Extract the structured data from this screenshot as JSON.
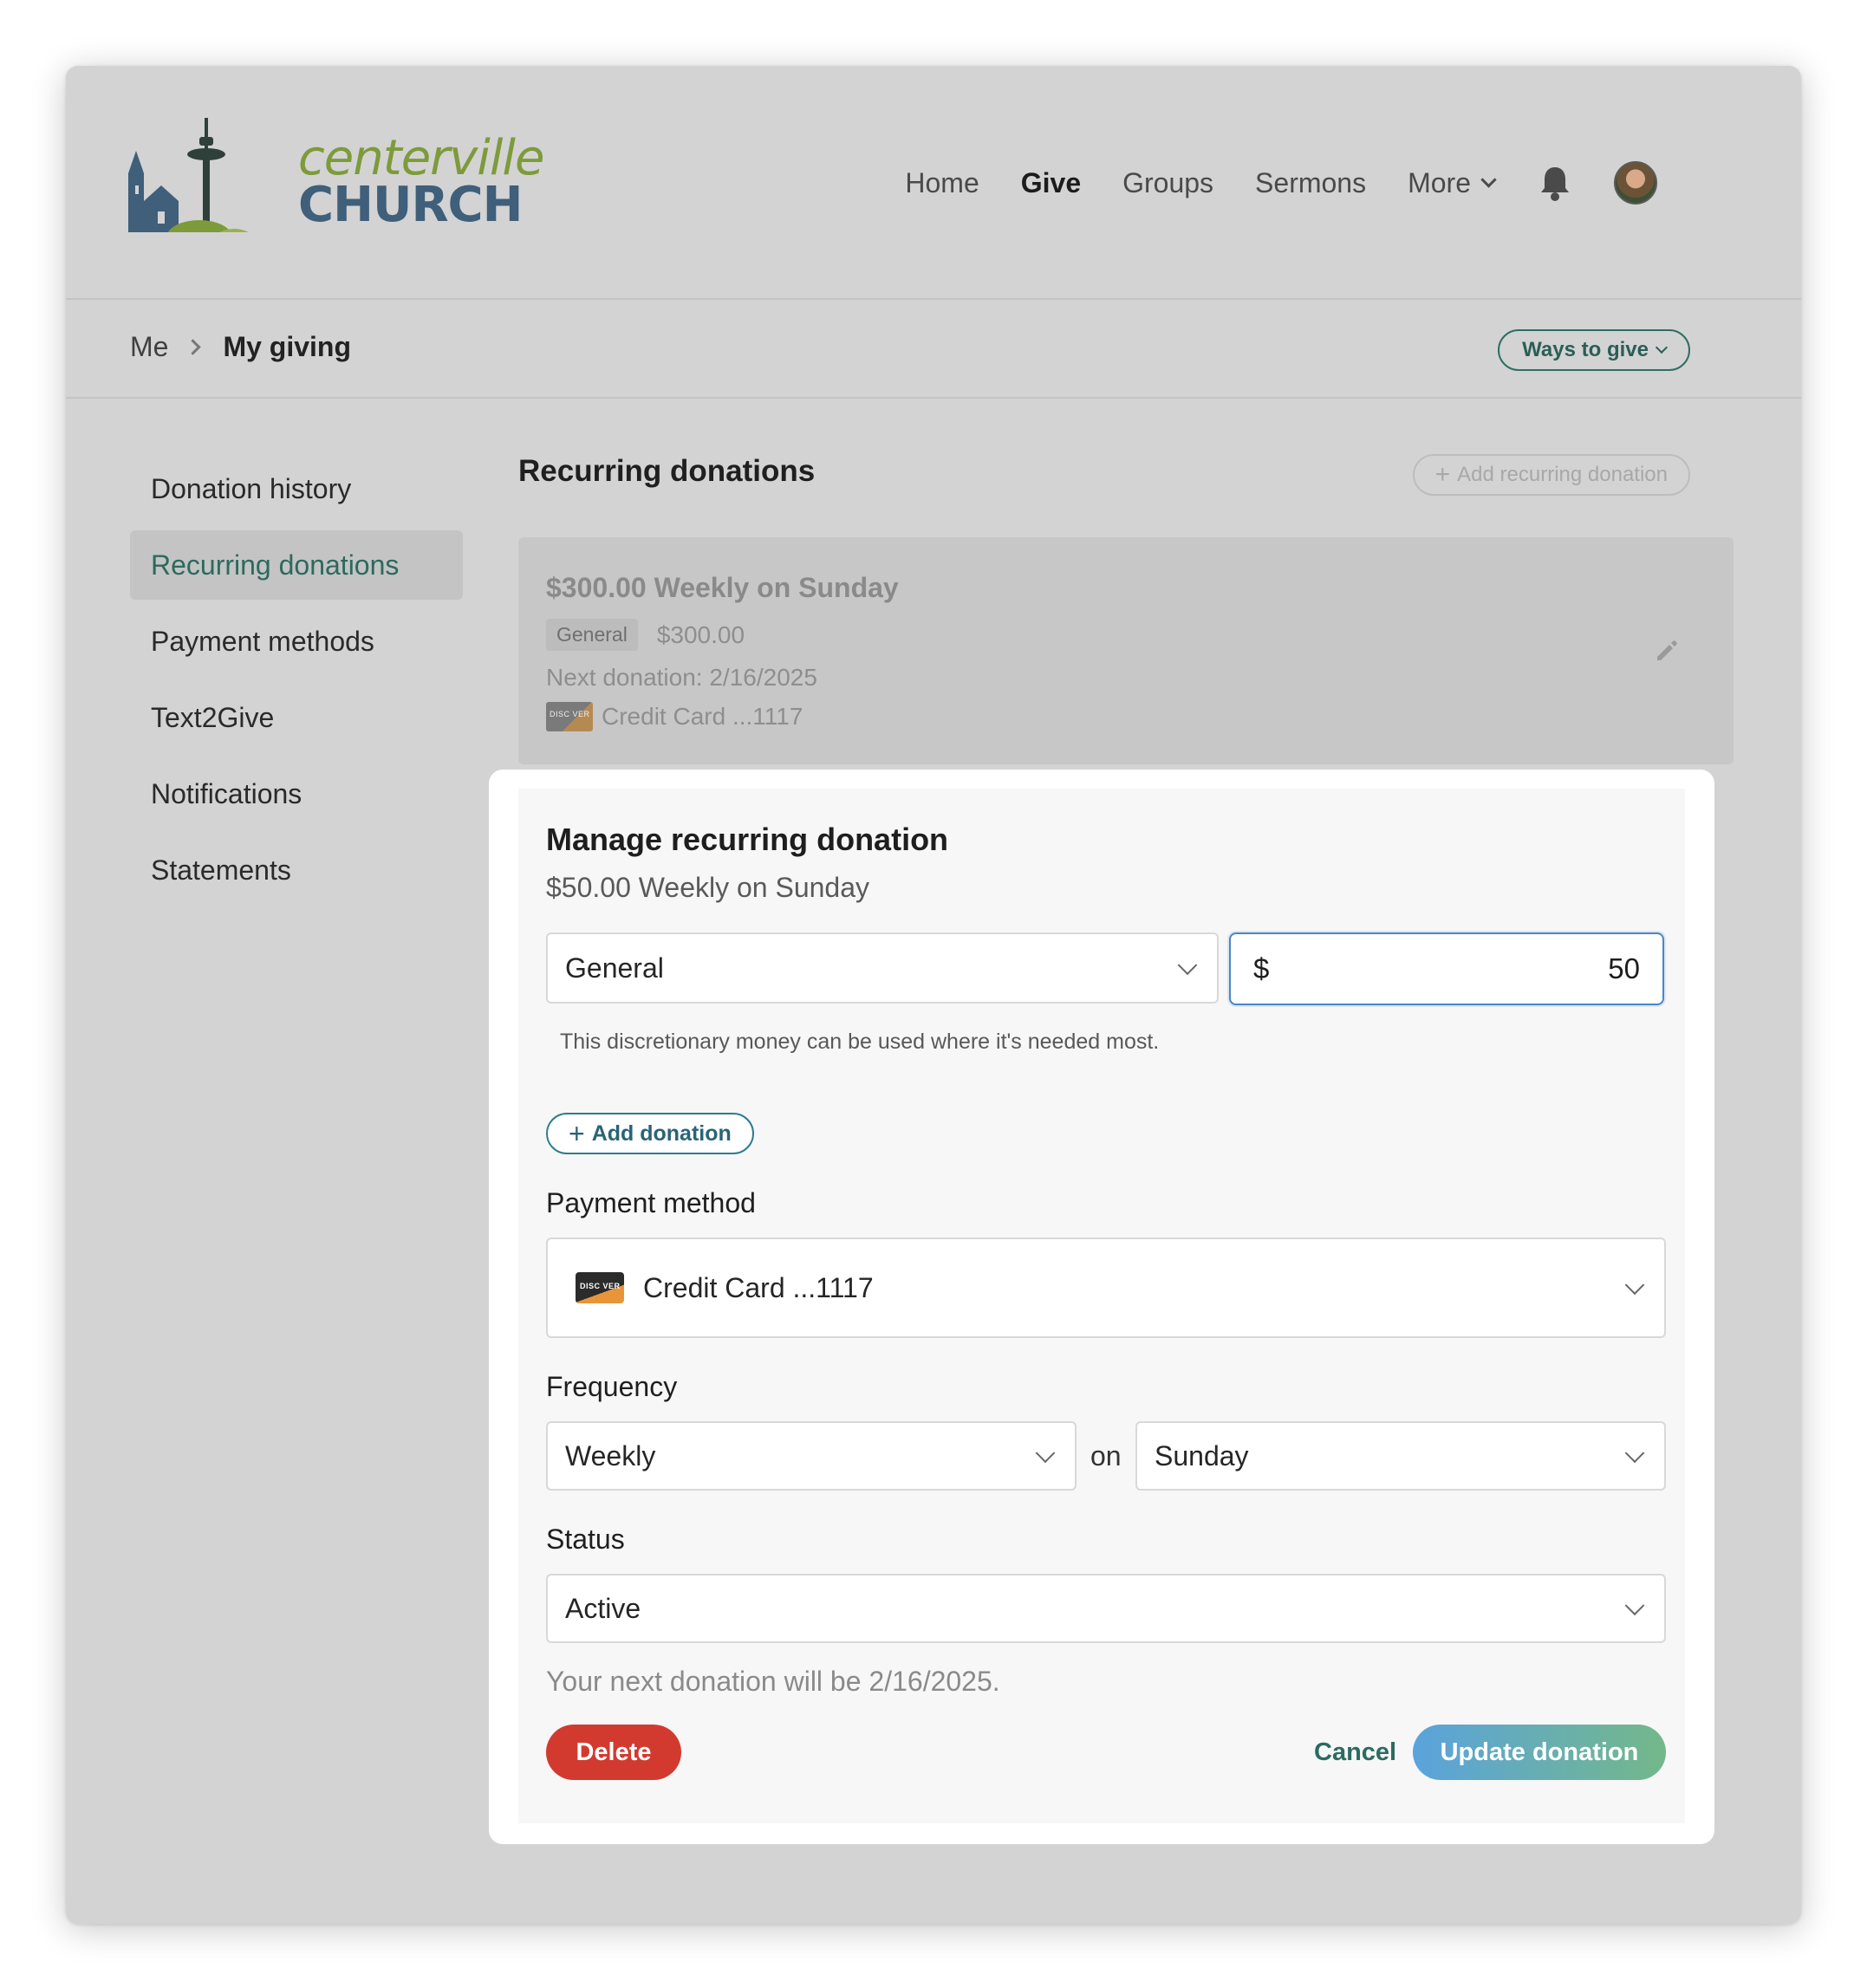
{
  "header": {
    "logo": {
      "line1": "centerville",
      "line2": "CHURCH"
    },
    "nav": [
      {
        "label": "Home"
      },
      {
        "label": "Give"
      },
      {
        "label": "Groups"
      },
      {
        "label": "Sermons"
      },
      {
        "label": "More"
      }
    ],
    "active_nav": "Give"
  },
  "breadcrumb": {
    "root": "Me",
    "current": "My giving"
  },
  "ways_to_give": "Ways to give",
  "sidebar": {
    "items": [
      {
        "label": "Donation history"
      },
      {
        "label": "Recurring donations"
      },
      {
        "label": "Payment methods"
      },
      {
        "label": "Text2Give"
      },
      {
        "label": "Notifications"
      },
      {
        "label": "Statements"
      }
    ],
    "active": "Recurring donations"
  },
  "main": {
    "title": "Recurring donations",
    "add_button": "Add recurring donation",
    "card": {
      "title": "$300.00 Weekly on Sunday",
      "fund": "General",
      "amount": "$300.00",
      "next": "Next donation: 2/16/2025",
      "payment": "Credit Card ...1117",
      "card_brand_text": "DISC VER"
    }
  },
  "modal": {
    "title": "Manage recurring donation",
    "subtitle": "$50.00 Weekly on Sunday",
    "fund_value": "General",
    "currency": "$",
    "amount_value": "50",
    "fund_help": "This discretionary money can be used where it's needed most.",
    "add_donation": "Add donation",
    "payment_label": "Payment method",
    "payment_value": "Credit Card ...1117",
    "card_brand_text": "DISC VER",
    "frequency_label": "Frequency",
    "frequency_value": "Weekly",
    "on_word": "on",
    "day_value": "Sunday",
    "status_label": "Status",
    "status_value": "Active",
    "next_note": "Your next donation will be 2/16/2025.",
    "delete": "Delete",
    "cancel": "Cancel",
    "update": "Update donation"
  },
  "colors": {
    "accent_green": "#2c6a5e",
    "delete_red": "#d23a30",
    "update_gradient_start": "#5aa3dd",
    "update_gradient_end": "#74b889",
    "focus_blue": "#4a86c9"
  }
}
